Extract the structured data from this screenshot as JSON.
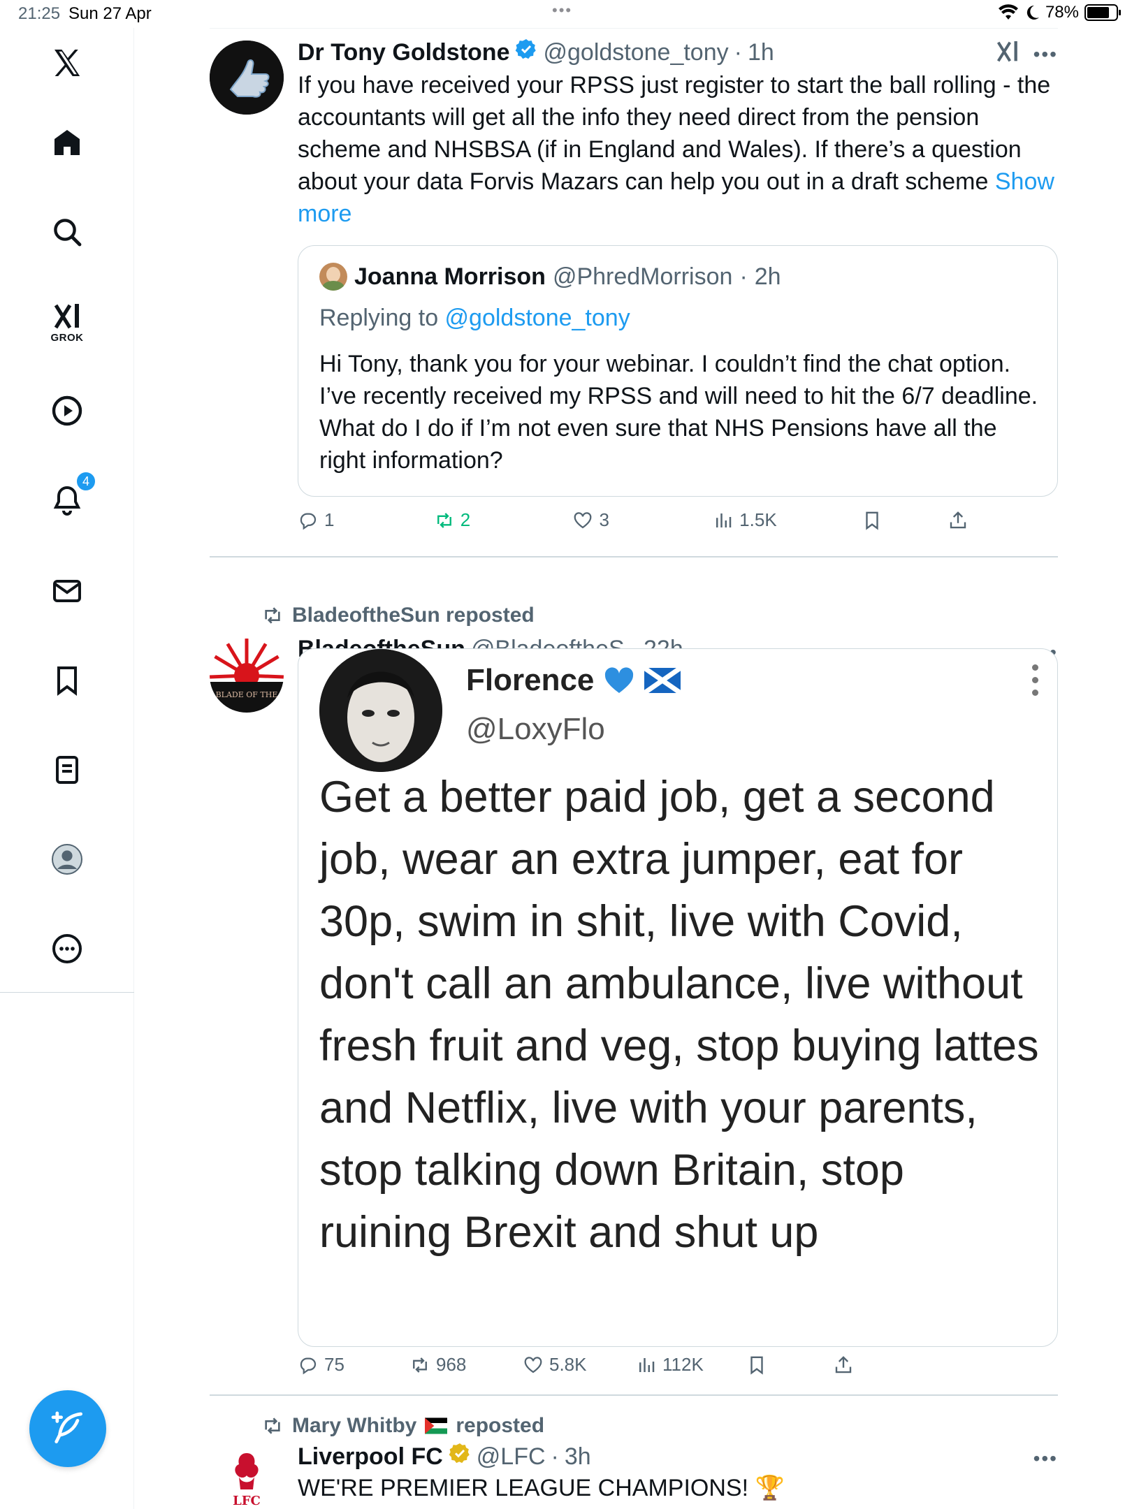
{
  "status_bar": {
    "time": "21:25",
    "date": "Sun 27 Apr",
    "battery": "78%",
    "battery_level": 0.78
  },
  "sidebar": {
    "grok_label": "GROK",
    "notifications_badge": "4"
  },
  "tweets": [
    {
      "name": "Dr Tony Goldstone",
      "handle": "@goldstone_tony",
      "sep": "·",
      "time": "1h",
      "text": "If you have received your RPSS just register to start the ball rolling - the accountants will get all the info they need direct from the pension scheme and NHSBSA (if in England and Wales). If there’s a question about your data Forvis Mazars can help you out in a draft scheme ",
      "show_more": "Show more",
      "quote": {
        "name": "Joanna Morrison",
        "handle": "@PhredMorrison",
        "sep": "·",
        "time": "2h",
        "replying_prefix": "Replying to ",
        "replying_handle": "@goldstone_tony",
        "text": "Hi Tony, thank you for your webinar. I couldn’t find the chat option. I’ve recently received my RPSS and will need to hit the 6/7 deadline. What do I do if I’m not even sure that NHS Pensions have all the right information?"
      },
      "stats": {
        "replies": "1",
        "reposts": "2",
        "likes": "3",
        "views": "1.5K"
      }
    },
    {
      "repost_by": "BladeoftheSun reposted",
      "name": "BladeoftheSun",
      "handle": "@BladeoftheS",
      "sep": "·",
      "time": "22h",
      "avatar_text": "BLADE OF THE",
      "image_quote": {
        "name": "Florence",
        "handle": "@LoxyFlo",
        "text": "Get a better paid job, get a second job, wear an extra jumper, eat for 30p, swim in shit, live with Covid, don't call an ambulance, live without fresh fruit and veg, stop buying lattes and Netflix, live with your parents, stop talking down Britain, stop ruining Brexit and shut up"
      },
      "stats": {
        "replies": "75",
        "reposts": "968",
        "likes": "5.8K",
        "views": "112K"
      }
    },
    {
      "repost_by_name": "Mary Whitby",
      "repost_by_suffix": "reposted",
      "name": "Liverpool FC",
      "handle": "@LFC",
      "sep": "·",
      "time": "3h",
      "text": "WE'RE PREMIER LEAGUE CHAMPIONS! 🏆",
      "avatar_text": "LFC"
    }
  ],
  "colors": {
    "accent": "#1d9bf0",
    "repost_green": "#00ba7c",
    "muted": "#536471",
    "gold_verified": "#e2b719"
  }
}
